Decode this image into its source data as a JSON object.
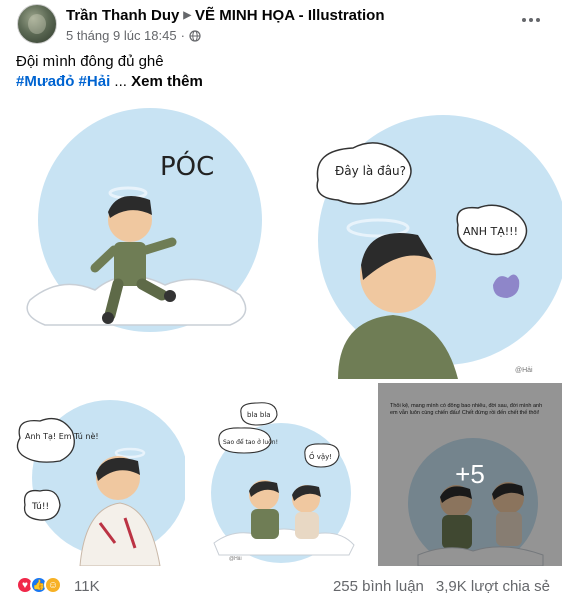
{
  "post": {
    "author": "Trần Thanh Duy",
    "page_name": "VẼ MINH HỌA - Illustration",
    "timestamp": "5 tháng 9 lúc 18:45",
    "dot": "·",
    "audience_icon": "globe-icon",
    "text": "Đội mình đông đủ ghê",
    "hashtags": [
      "#Mưađỏ",
      "#Hải"
    ],
    "ellipsis": "...",
    "see_more": "Xem thêm"
  },
  "gallery": {
    "panel1": {
      "sfx": "PÓC",
      "watermark": ""
    },
    "panel2": {
      "bubble": "Đây là đâu?",
      "shout": "ANH TẠ!!!",
      "watermark": "@Hải"
    },
    "panel3": {
      "bubble1": "Anh Tạ! Em Tú nè!",
      "bubble2": "Tú!!"
    },
    "panel4": {
      "bubble1": "bla bla",
      "bubble2": "Sao để tao ở luôn!",
      "bubble3": "Ồ vậy!",
      "watermark": "@Hải"
    },
    "panel5": {
      "caption": "Thôi kệ, mang mình có đông bao nhiêu, đời sau, đời mình anh em vẫn luôn cùng chiến đấu! Chết đứng rồi đến chết thế thôi!",
      "more_count": "+5"
    }
  },
  "footer": {
    "reaction_icons": [
      "love-icon",
      "like-icon",
      "care-icon"
    ],
    "reaction_count": "11K",
    "comments": "255 bình luận",
    "shares": "3,9K lượt chia sẻ"
  }
}
